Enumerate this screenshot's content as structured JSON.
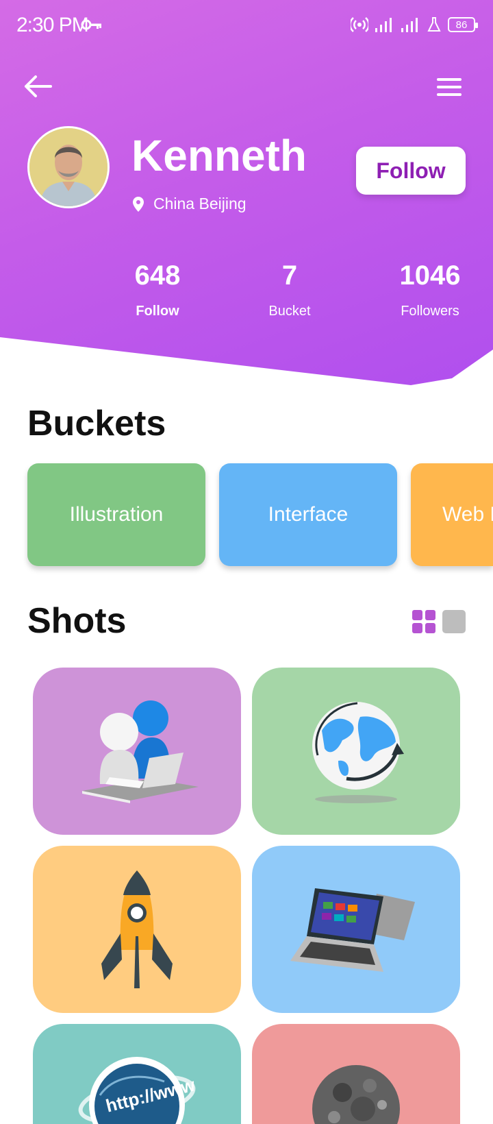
{
  "status_bar": {
    "time": "2:30 PM",
    "battery": "86",
    "icons": [
      "key-icon",
      "hotspot-icon",
      "signal-icon",
      "signal-icon",
      "lab-icon",
      "battery-icon"
    ]
  },
  "header": {
    "gradient_colors": [
      "#d46be6",
      "#b04fee"
    ],
    "back_icon": "arrow-left-icon",
    "menu_icon": "hamburger-menu-icon"
  },
  "profile": {
    "name": "Kenneth",
    "location": "China Beijing",
    "follow_button": "Follow"
  },
  "stats": [
    {
      "value": "648",
      "label": "Follow"
    },
    {
      "value": "7",
      "label": "Bucket"
    },
    {
      "value": "1046",
      "label": "Followers"
    }
  ],
  "buckets": {
    "title": "Buckets",
    "items": [
      {
        "label": "Illustration",
        "color": "#81c784"
      },
      {
        "label": "Interface",
        "color": "#64b5f6"
      },
      {
        "label": "Web D",
        "color": "#ffb74d"
      }
    ]
  },
  "shots": {
    "title": "Shots",
    "view_toggle": [
      "grid-view-icon",
      "single-view-icon"
    ],
    "items": [
      {
        "image": "figure-laptop-illustration",
        "color": "#ce93d8"
      },
      {
        "image": "globe-arrows-illustration",
        "color": "#a5d6a7"
      },
      {
        "image": "rocket-illustration",
        "color": "#ffcc80"
      },
      {
        "image": "laptop-illustration",
        "color": "#90caf9"
      },
      {
        "image": "http-globe-illustration",
        "color": "#80cbc4",
        "text": "http://www"
      },
      {
        "image": "moon-illustration",
        "color": "#ef9a9a"
      }
    ]
  }
}
